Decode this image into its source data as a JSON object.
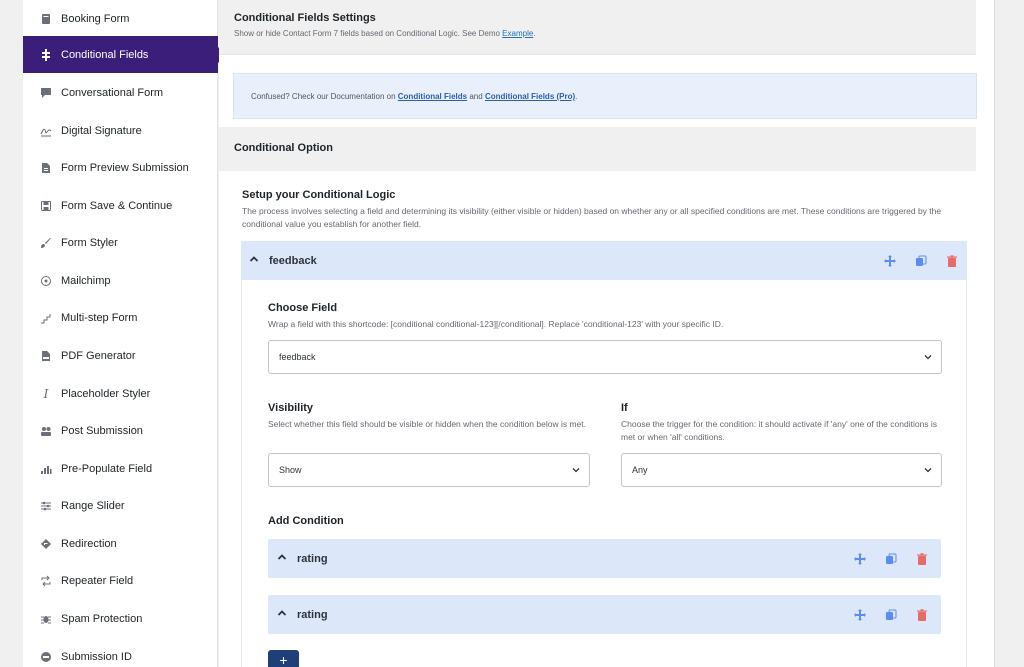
{
  "sidebar": {
    "items": [
      {
        "label": "Booking Form",
        "icon": "book-icon",
        "active": false
      },
      {
        "label": "Conditional Fields",
        "icon": "puzzle-icon",
        "active": true
      },
      {
        "label": "Conversational Form",
        "icon": "chat-icon",
        "active": false
      },
      {
        "label": "Digital Signature",
        "icon": "signature-icon",
        "active": false
      },
      {
        "label": "Form Preview Submission",
        "icon": "document-icon",
        "active": false
      },
      {
        "label": "Form Save & Continue",
        "icon": "save-icon",
        "active": false
      },
      {
        "label": "Form Styler",
        "icon": "brush-icon",
        "active": false
      },
      {
        "label": "Mailchimp",
        "icon": "mailchimp-icon",
        "active": false
      },
      {
        "label": "Multi-step Form",
        "icon": "steps-icon",
        "active": false
      },
      {
        "label": "PDF Generator",
        "icon": "pdf-icon",
        "active": false
      },
      {
        "label": "Placeholder Styler",
        "icon": "italic-icon",
        "active": false
      },
      {
        "label": "Post Submission",
        "icon": "users-icon",
        "active": false
      },
      {
        "label": "Pre-Populate Field",
        "icon": "chart-icon",
        "active": false
      },
      {
        "label": "Range Slider",
        "icon": "sliders-icon",
        "active": false
      },
      {
        "label": "Redirection",
        "icon": "redirect-icon",
        "active": false
      },
      {
        "label": "Repeater Field",
        "icon": "repeat-icon",
        "active": false
      },
      {
        "label": "Spam Protection",
        "icon": "bug-icon",
        "active": false
      },
      {
        "label": "Submission ID",
        "icon": "id-icon",
        "active": false
      }
    ]
  },
  "header": {
    "title": "Conditional Fields Settings",
    "subtitle": "Show or hide Contact Form 7 fields based on Conditional Logic. See Demo",
    "example_link": "Example",
    "period": "."
  },
  "notice": {
    "text_before": "Confused? Check our Documentation on",
    "link1": "Conditional Fields",
    "text_mid": "and",
    "link2": "Conditional Fields (Pro)",
    "text_after": "."
  },
  "conditional_option": {
    "title": "Conditional Option"
  },
  "setup": {
    "title": "Setup your Conditional Logic",
    "description": "The process involves selecting a field and determining its visibility (either visible or hidden) based on whether any or all specified conditions are met. These conditions are triggered by the conditional value you establish for another field."
  },
  "group": {
    "name": "feedback",
    "choose_field": {
      "label": "Choose Field",
      "help": "Wrap a field with this shortcode: [conditional conditional-123][/conditional]. Replace 'conditional-123' with your specific ID.",
      "value": "feedback"
    },
    "visibility": {
      "label": "Visibility",
      "help": "Select whether this field should be visible or hidden when the condition below is met.",
      "value": "Show"
    },
    "if": {
      "label": "If",
      "help": "Choose the trigger for the condition: it should activate if 'any' one of the conditions is met or when 'all' conditions.",
      "value": "Any"
    },
    "add_condition_label": "Add Condition",
    "conditions": [
      {
        "name": "rating"
      },
      {
        "name": "rating"
      }
    ],
    "add_button": "+"
  },
  "colors": {
    "active_sidebar": "#3b1e7a",
    "accent_blue": "#5b8def",
    "delete_red": "#e66a6a",
    "bar_bg": "#dde7fa",
    "status_dot": "#14a085"
  }
}
